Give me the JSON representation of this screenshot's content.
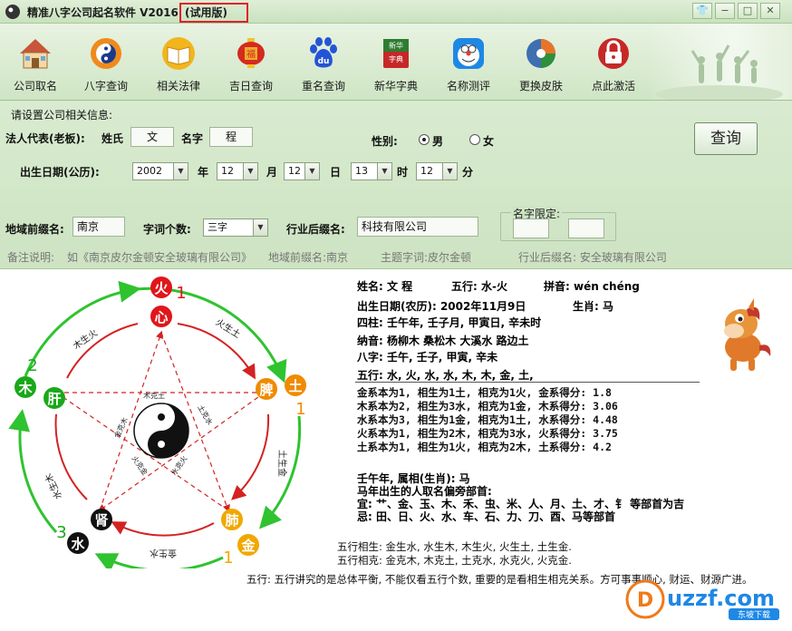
{
  "window": {
    "title": "精准八字公司起名软件 V2016",
    "trial_label": "(试用版)",
    "controls": [
      "👕",
      "−",
      "□",
      "✕"
    ]
  },
  "toolbar": {
    "items": [
      {
        "label": "公司取名",
        "icon": "house-icon",
        "color": "#c9553a"
      },
      {
        "label": "八字查询",
        "icon": "yin-yang-icon",
        "color": "#f08a1c"
      },
      {
        "label": "相关法律",
        "icon": "book-icon",
        "color": "#f2b51e"
      },
      {
        "label": "吉日查询",
        "icon": "lantern-icon",
        "color": "#d52a1e"
      },
      {
        "label": "重名查询",
        "icon": "baidu-paw-icon",
        "color": "#2454d6"
      },
      {
        "label": "新华字典",
        "icon": "dictionary-icon",
        "color": "#2e7d32"
      },
      {
        "label": "名称测评",
        "icon": "doraemon-icon",
        "color": "#1e88e5"
      },
      {
        "label": "更换皮肤",
        "icon": "palette-icon",
        "color": "#3e6fb0"
      },
      {
        "label": "点此激活",
        "icon": "lock-icon",
        "color": "#c62828"
      }
    ]
  },
  "form": {
    "section_title": "请设置公司相关信息:",
    "rep_label": "法人代表(老板):",
    "surname_label": "姓氏",
    "surname_value": "文",
    "name_label": "名字",
    "name_value": "程",
    "gender_label": "性别:",
    "gender_male": "男",
    "gender_female": "女",
    "query_button": "查询",
    "birth_label": "出生日期(公历):",
    "year_value": "2002",
    "year_unit": "年",
    "month_value": "12",
    "month_unit": "月",
    "day_value": "12",
    "day_unit": "日",
    "hour_value": "13",
    "hour_unit": "时",
    "minute_value": "12",
    "minute_unit": "分",
    "region_label": "地域前缀名:",
    "region_value": "南京",
    "wordcount_label": "字词个数:",
    "wordcount_value": "三字",
    "industry_label": "行业后缀名:",
    "industry_value": "科技有限公司",
    "limit_label": "名字限定:",
    "note_label": "备注说明:",
    "note_example": "如《南京皮尔金顿安全玻璃有限公司》",
    "note_region": "地域前缀名:南京",
    "note_theme": "主题字词:皮尔金顿",
    "note_industry": "行业后缀名:  安全玻璃有限公司"
  },
  "diagram": {
    "nodes": {
      "fire": {
        "element": "火",
        "organ": "心",
        "number": "1"
      },
      "earth": {
        "element": "土",
        "organ": "脾",
        "number": "1"
      },
      "metal": {
        "element": "金",
        "organ": "肺",
        "number": "1"
      },
      "water": {
        "element": "水",
        "organ": "肾",
        "number": "3"
      },
      "wood": {
        "element": "木",
        "organ": "肝",
        "number": "2"
      }
    },
    "outer_labels": [
      "木生火",
      "火生土",
      "土生金",
      "金生水",
      "水生木"
    ],
    "inner_labels": [
      "木克土",
      "土克水",
      "水克火",
      "火克金",
      "金克木"
    ],
    "colors": {
      "fire": "#e0161b",
      "earth": "#f08a00",
      "metal": "#f0a800",
      "water": "#111111",
      "wood": "#1aa81a",
      "generate": "#2fc32f",
      "restrain": "#d32222"
    }
  },
  "result": {
    "line_name": "姓名: 文  程",
    "line_wuxing": "五行: 水-火",
    "line_pinyin": "拼音: wén chéng",
    "line_lunar": "出生日期(农历): 2002年11月9日",
    "line_zodiac": "生肖: 马",
    "line_sizhu": "四柱:  壬午年, 壬子月, 甲寅日, 辛未时",
    "line_nayin": "纳音:  杨柳木  桑松木  大溪水  路边土",
    "line_bazi": "八字:  壬午, 壬子, 甲寅, 辛未",
    "line_wuxing_list": "五行:  水, 火, 水, 水, 木, 木, 金, 土,",
    "scores": [
      "金系本为1, 相生为1土, 相克为1火, 金系得分: 1.8",
      "木系本为2, 相生为3水, 相克为1金, 木系得分: 3.06",
      "水系本为3, 相生为1金, 相克为1土, 水系得分: 4.48",
      "火系本为1, 相生为2木, 相克为3水, 火系得分: 3.75",
      "土系本为1, 相生为1火, 相克为2木, 土系得分: 4.2"
    ],
    "zodiac_title": "壬午年, 属相(生肖): 马",
    "zodiac_sub": "马年出生的人取名偏旁部首:",
    "zodiac_good": "宜: 艹、金、玉、木、禾、虫、米、人、月、土、才、钅 等部首为吉",
    "zodiac_bad": "忌: 田、日、火、水、车、石、力、刀、酉、马等部首",
    "xiangsheng": "五行相生: 金生水,  水生木,  木生火,  火生土,  土生金.",
    "xiangke": "五行相克: 金克木,  木克土,  土克水,  水克火,  火克金.",
    "footer": "五行: 五行讲究的是总体平衡, 不能仅看五行个数, 重要的是看相生相克关系。方可事事顺心, 财运、财源广进。"
  },
  "watermark": {
    "brand": "uzzf.com",
    "sub": "东坡下载"
  }
}
